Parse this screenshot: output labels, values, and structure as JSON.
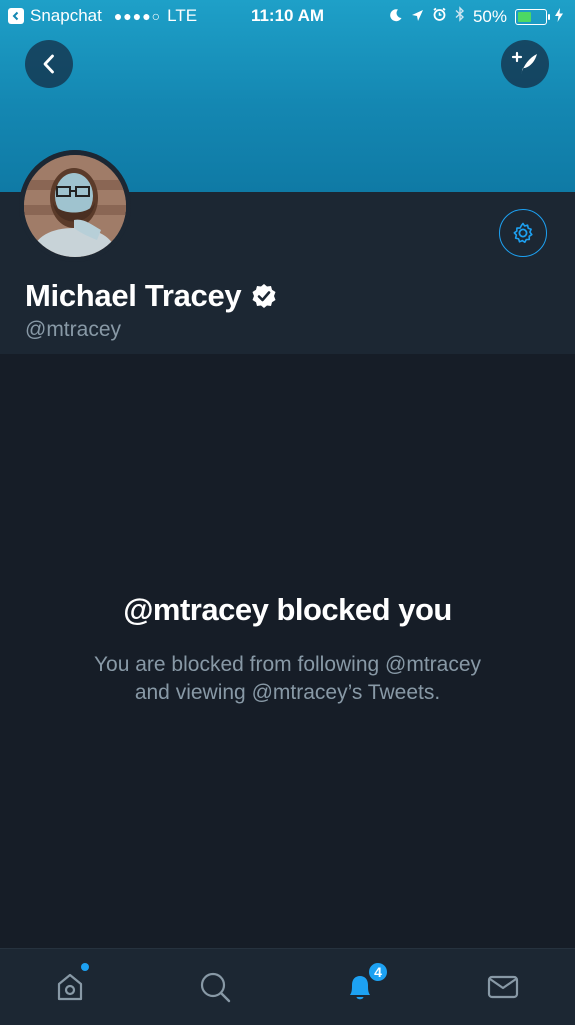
{
  "status_bar": {
    "carrier_app": "Snapchat",
    "signal_dots": "●●●●○",
    "network": "LTE",
    "time": "11:10 AM",
    "battery_percent": "50%",
    "battery_level": 0.5
  },
  "profile": {
    "name": "Michael Tracey",
    "handle": "@mtracey",
    "verified": true
  },
  "blocked": {
    "title": "@mtracey blocked you",
    "line1": "You are blocked from following @mtracey",
    "line2": "and viewing @mtracey’s Tweets."
  },
  "tabbar": {
    "notifications_badge": "4",
    "tabs": [
      "home-icon",
      "search-icon",
      "notifications-icon",
      "messages-icon"
    ]
  },
  "colors": {
    "accent": "#1da1f2",
    "background": "#161d27",
    "card": "#1c2733",
    "secondary_text": "#8899a6",
    "header": "#1487b2"
  }
}
